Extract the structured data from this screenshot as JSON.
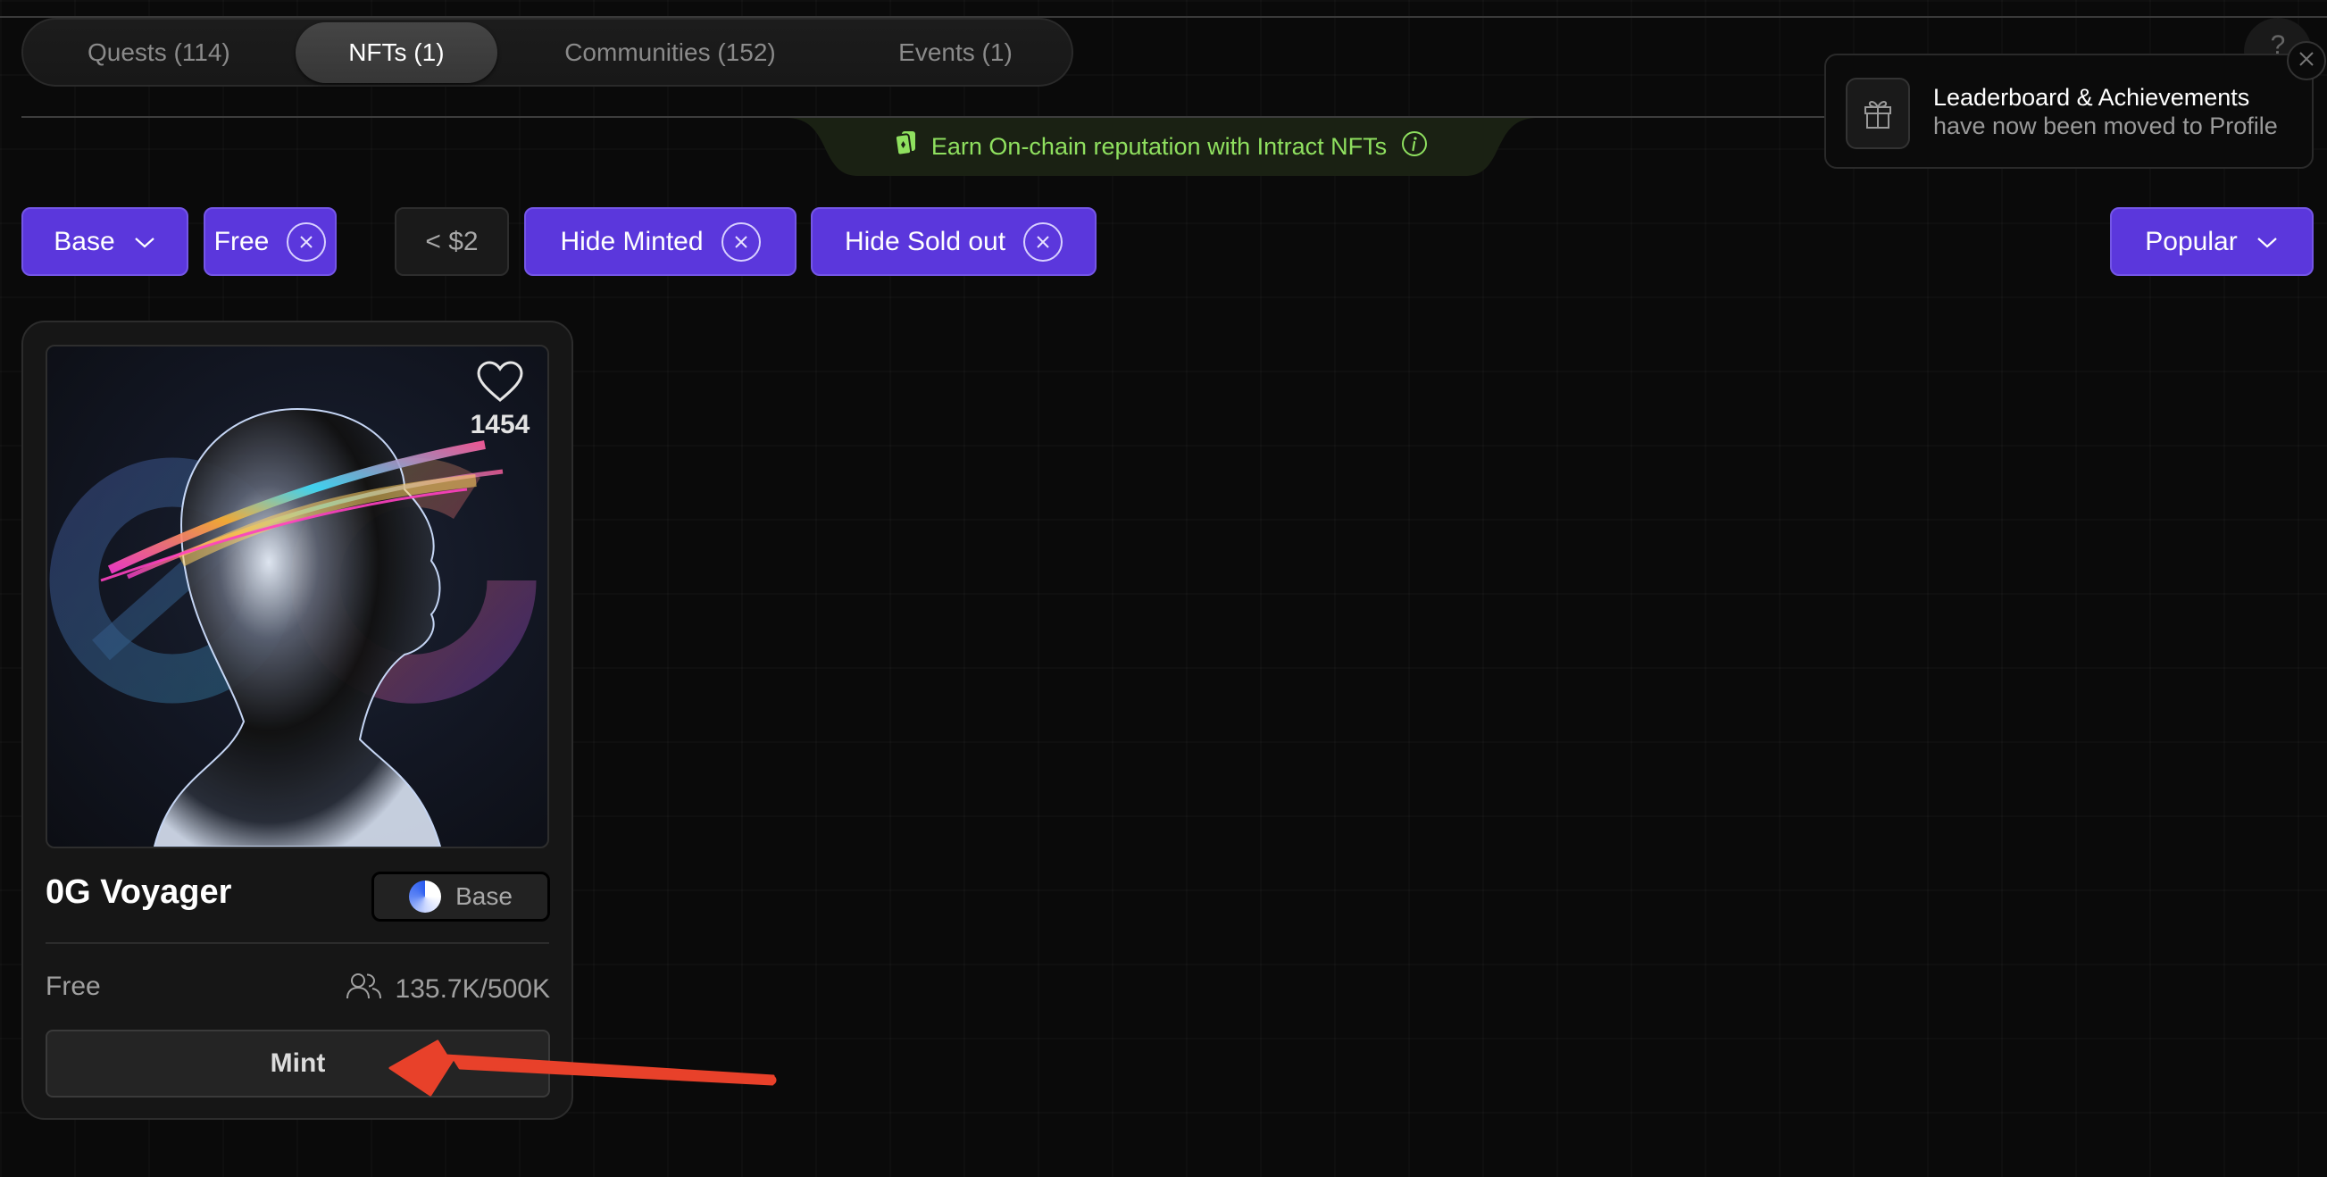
{
  "tabs": [
    {
      "label": "Quests (114)",
      "active": false
    },
    {
      "label": "NFTs (1)",
      "active": true
    },
    {
      "label": "Communities (152)",
      "active": false
    },
    {
      "label": "Events (1)",
      "active": false
    }
  ],
  "help_button": {
    "label": "?"
  },
  "banner": {
    "text": "Earn On-chain reputation with Intract NFTs",
    "icon": "cards-icon",
    "info_icon": "info-icon",
    "color": "#8fe05f"
  },
  "filters": [
    {
      "label": "Base",
      "type": "dropdown",
      "active": true
    },
    {
      "label": "Free",
      "type": "removable",
      "active": true
    },
    {
      "label": "< $2",
      "type": "toggle",
      "active": false
    },
    {
      "label": "Hide Minted",
      "type": "removable",
      "active": true
    },
    {
      "label": "Hide Sold out",
      "type": "removable",
      "active": true
    }
  ],
  "sort": {
    "label": "Popular"
  },
  "accent_color": "#5b37dc",
  "nft_card": {
    "title": "0G Voyager",
    "image": "chrome humanoid head with neon light streaks over 0G logo",
    "likes": "1454",
    "chain": "Base",
    "price": "Free",
    "minted": "135.7K/500K",
    "mint_button": "Mint"
  },
  "toast": {
    "title": "Leaderboard & Achievements",
    "subtitle": "have now been moved to Profile",
    "icon": "gift-icon"
  },
  "annotation": {
    "type": "arrow",
    "color": "#e8412a",
    "points_to": "mint-button"
  }
}
